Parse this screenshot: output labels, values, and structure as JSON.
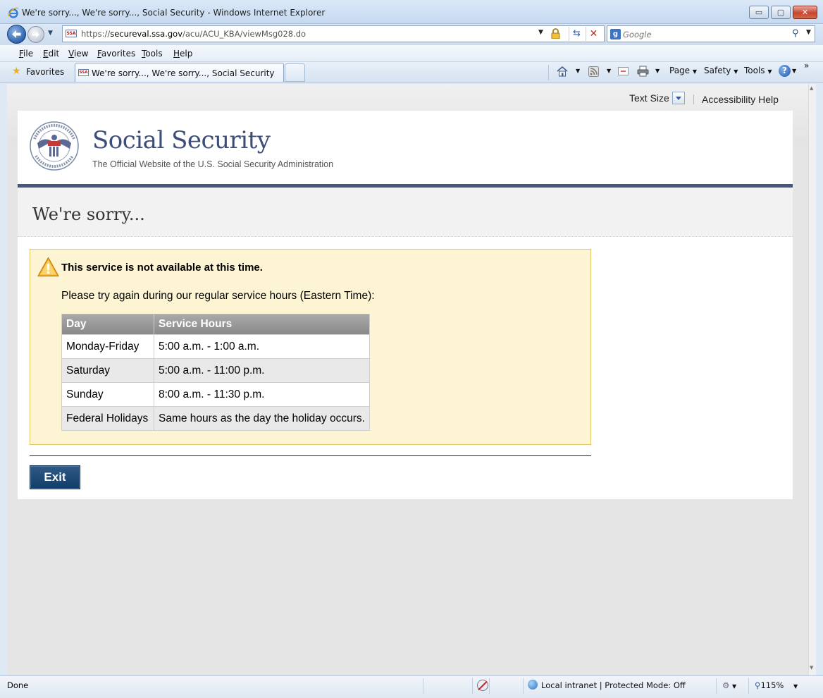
{
  "window": {
    "title": "We're sorry..., We're sorry..., Social Security - Windows Internet Explorer",
    "minimize": "▭",
    "maximize": "▢",
    "close": "✕"
  },
  "address": {
    "url_prefix": "https://",
    "url_host": "secureval.ssa.gov",
    "url_path": "/acu/ACU_KBA/viewMsg028.do",
    "favicon_text": "SSA"
  },
  "search": {
    "placeholder": "Google",
    "engine_icon": "g"
  },
  "menu": [
    "File",
    "Edit",
    "View",
    "Favorites",
    "Tools",
    "Help"
  ],
  "favorites_bar": {
    "favorites_label": "Favorites",
    "tab_title": "We're sorry..., We're sorry..., Social Security"
  },
  "command_bar": {
    "page": "Page",
    "safety": "Safety",
    "tools": "Tools",
    "help_icon": "?",
    "overflow": "»"
  },
  "utility": {
    "text_size": "Text Size",
    "accessibility_help": "Accessibility Help"
  },
  "header": {
    "title": "Social Security",
    "subtitle": "The Official Website of the U.S. Social Security Administration"
  },
  "main": {
    "heading": "We're sorry...",
    "alert_title": "This service is not available at this time.",
    "alert_text": "Please try again during our regular service hours (Eastern Time):",
    "table": {
      "headers": [
        "Day",
        "Service Hours"
      ],
      "rows": [
        [
          "Monday-Friday",
          "5:00 a.m. - 1:00 a.m."
        ],
        [
          "Saturday",
          "5:00 a.m. - 11:00 p.m."
        ],
        [
          "Sunday",
          "8:00 a.m. - 11:30 p.m."
        ],
        [
          "Federal Holidays",
          "Same hours as the day the holiday occurs."
        ]
      ]
    },
    "exit_label": "Exit"
  },
  "status": {
    "text": "Done",
    "zone": "Local intranet | Protected Mode: Off",
    "zoom": "115%"
  },
  "colors": {
    "brand_navy": "#3c4d78",
    "alert_bg": "#fdf4d3",
    "alert_border": "#e2c764",
    "button": "#1b466f"
  }
}
